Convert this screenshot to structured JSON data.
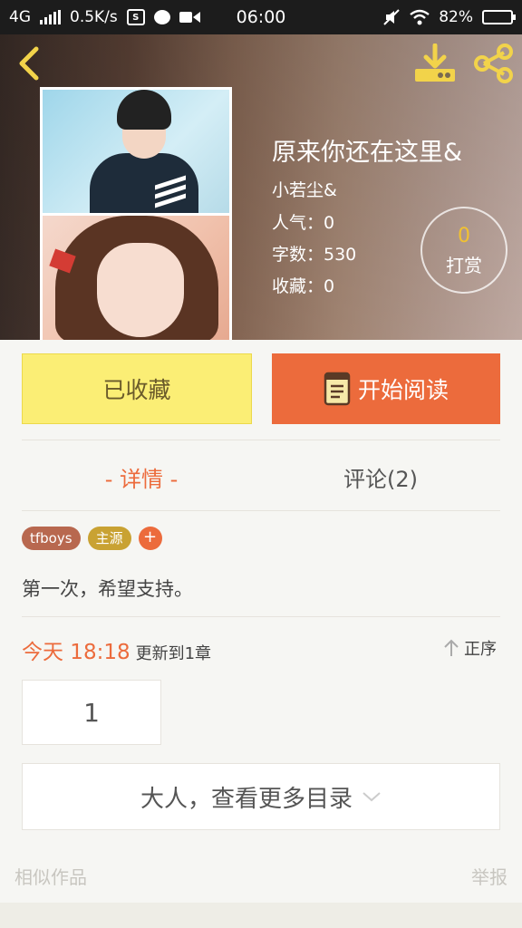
{
  "status_bar": {
    "network": "4G",
    "speed": "0.5K/s",
    "time": "06:00",
    "battery": "82%",
    "battery_level": 0.82
  },
  "header": {
    "title": "原来你还在这里&",
    "author": "小若尘&",
    "popularity": "人气：0",
    "word_count": "字数：530",
    "favorites": "收藏：0",
    "reward_count": "0",
    "reward_label": "打赏",
    "icons": [
      "chevron-left-icon",
      "download-icon",
      "share-icon"
    ]
  },
  "actions": {
    "collect_label": "已收藏",
    "read_label": "开始阅读"
  },
  "tabs": [
    {
      "label": "- 详情 -",
      "active": true
    },
    {
      "label": "评论(2)",
      "active": false
    }
  ],
  "tags": [
    {
      "label": "tfboys",
      "color": "#b8684f"
    },
    {
      "label": "主源",
      "color": "#c9a233"
    }
  ],
  "tag_add": "+",
  "intro": "第一次，希望支持。",
  "update": {
    "time": "今天 18:18",
    "text": "更新到1章",
    "sort_label": "正序"
  },
  "chapters": [
    "1"
  ],
  "more_catalog": "大人，查看更多目录",
  "footer": {
    "similar": "相似作品",
    "report": "举报"
  },
  "colors": {
    "accent": "#ec6b3c",
    "collect_bg": "#fbee75",
    "reward_num": "#f2c230"
  }
}
